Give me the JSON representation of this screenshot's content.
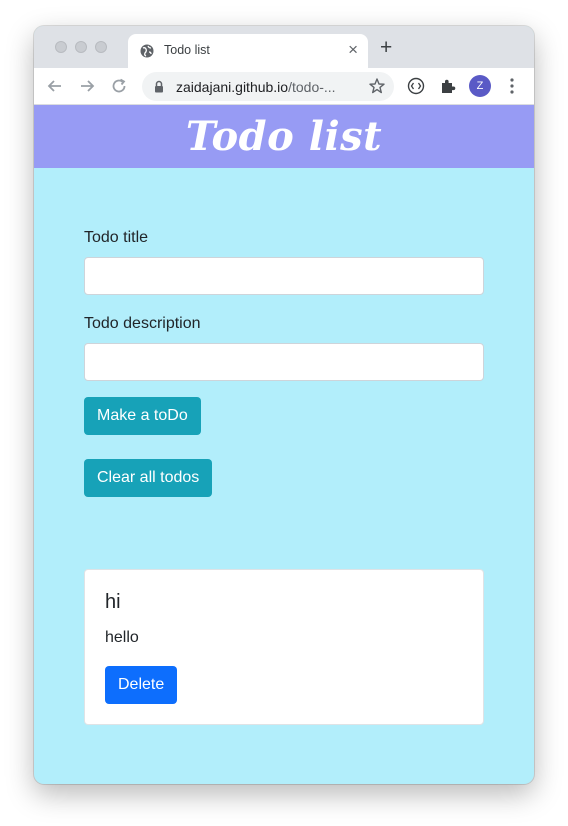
{
  "browser": {
    "tab_title": "Todo list",
    "tab_close": "×",
    "new_tab": "+",
    "url_host": "zaidajani.github.io",
    "url_path": "/todo-...",
    "profile_initial": "Z"
  },
  "page": {
    "heading": "Todo list",
    "title_label": "Todo title",
    "title_value": "",
    "description_label": "Todo description",
    "description_value": "",
    "make_button": "Make a toDo",
    "clear_button": "Clear all todos"
  },
  "todos": [
    {
      "title": "hi",
      "description": "hello",
      "delete_label": "Delete"
    }
  ],
  "colors": {
    "header_bg": "#979bf4",
    "page_bg": "#b2eefb",
    "teal_button": "#17a2b8",
    "delete_button": "#0d6efd"
  },
  "icons": {
    "tab_favicon": "globe-icon",
    "back": "arrow-left-icon",
    "forward": "arrow-right-icon",
    "reload": "reload-icon",
    "lock": "lock-icon",
    "bookmark": "star-icon",
    "extension1": "circle-code-icon",
    "extensions": "puzzle-icon",
    "menu": "kebab-menu-icon"
  }
}
